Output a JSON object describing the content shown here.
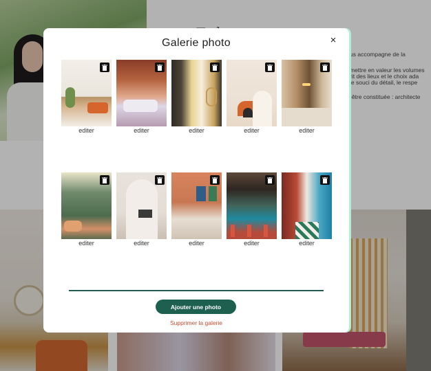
{
  "background": {
    "text_lines": [
      "us accompagne de la",
      "mettre en valeur les volumes",
      "rit des lieux et le choix ada",
      "le souci du détail, le respe",
      "-être constituée : architecte"
    ]
  },
  "modal": {
    "title": "Galerie photo",
    "close_label": "×",
    "photos": [
      {
        "edit_label": "editer"
      },
      {
        "edit_label": "editer"
      },
      {
        "edit_label": "editer"
      },
      {
        "edit_label": "editer"
      },
      {
        "edit_label": "editer"
      },
      {
        "edit_label": "editer"
      },
      {
        "edit_label": "editer"
      },
      {
        "edit_label": "editer"
      },
      {
        "edit_label": "editer"
      },
      {
        "edit_label": "editer"
      }
    ],
    "add_button_label": "Ajouter une photo",
    "delete_gallery_label": "Supprimer la galerie"
  },
  "colors": {
    "accent": "#1d6050",
    "danger": "#d1492e",
    "modal_border": "#b5ecd7"
  }
}
